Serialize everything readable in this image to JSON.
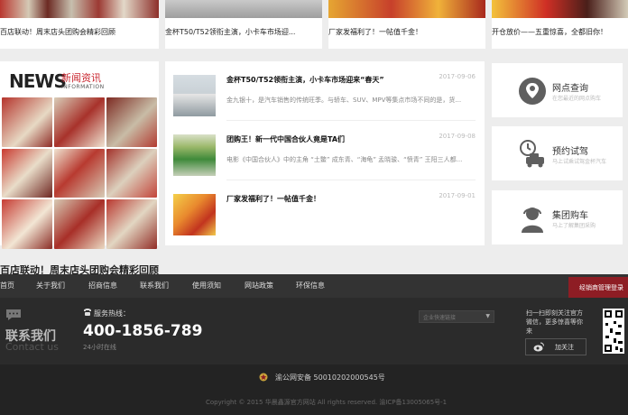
{
  "top_captions": [
    "百店联动！周末店头团购会精彩回顾",
    "金杯T50/T52领衔主演，小卡车市场迎...",
    "厂家发福利了！一帖值千金！",
    "开仓放价——五重惊喜，全都旧你！"
  ],
  "news": {
    "logo_big": "NEWS",
    "logo_cn": "新闻资讯",
    "logo_en": "INFORMATION",
    "caption": "百店联动！周末店头团购会精彩回顾"
  },
  "news_list": [
    {
      "title": "金杯T50/T52领衔主演，小卡车市场迎来“春天”",
      "date": "2017-09-06",
      "desc": "金九银十，是汽车销售的传统旺季。与轿车、SUV、MPV等集点市场不同的是，货..."
    },
    {
      "title": "团购王！新一代中国合伙人竟是TA们",
      "date": "2017-09-08",
      "desc": "电影《中国合伙人》中的主角 “土鳖” 成东青、“海龟” 孟晓骏、“愤青” 王阳三人都..."
    },
    {
      "title": "厂家发福利了！一帖值千金！",
      "date": "2017-09-01",
      "desc": ""
    }
  ],
  "services": [
    {
      "title": "网点查询",
      "sub": "在您最近的网点购车",
      "icon": "location-icon"
    },
    {
      "title": "预约试驾",
      "sub": "马上试乘试驾金杯汽车",
      "icon": "test-drive-icon"
    },
    {
      "title": "集团购车",
      "sub": "马上了解集团采购",
      "icon": "customer-service-icon"
    }
  ],
  "footer_nav": [
    "首页",
    "关于我们",
    "招商信息",
    "联系我们",
    "使用须知",
    "网站政策",
    "环保信息"
  ],
  "dealer_button": "经销商管理登录",
  "contact": {
    "title": "联系我们",
    "title_en": "Contact us",
    "hotline_label": "服务热线：",
    "hotline_number": "400-1856-789",
    "hotline_sub": "24小时在线",
    "quick_link_placeholder": "企业快速链接",
    "qr_text": "扫一扫即刻关注官方微信，更多惊喜等你来",
    "follow_label": "加关注"
  },
  "police_record": "渝公网安备 50010202000545号",
  "copyright": "Copyright © 2015 华晨鑫源官方网站 All rights reserved. 渝ICP备13005065号-1"
}
